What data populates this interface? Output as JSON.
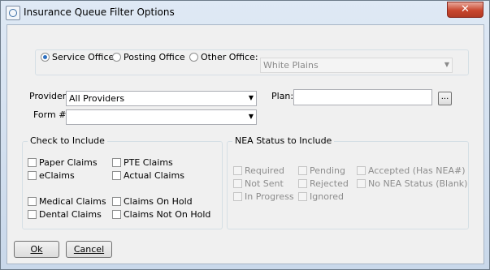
{
  "window": {
    "title": "Insurance Queue Filter Options",
    "close_glyph": "✕"
  },
  "office": {
    "options": [
      {
        "label": "Service Office",
        "selected": true
      },
      {
        "label": "Posting Office",
        "selected": false
      },
      {
        "label": "Other Office:",
        "selected": false
      }
    ],
    "other_office_value": "White Plains"
  },
  "provider": {
    "label": "Provider:",
    "value": "All Providers"
  },
  "form": {
    "label": "Form #:",
    "value": ""
  },
  "plan": {
    "label": "Plan:",
    "value": "",
    "browse_label": "..."
  },
  "check_to_include": {
    "title": "Check to Include",
    "items": [
      "Paper Claims",
      "PTE Claims",
      "eClaims",
      "Actual Claims",
      "Medical Claims",
      "Claims On Hold",
      "Dental Claims",
      "Claims Not On Hold"
    ]
  },
  "nea_status": {
    "title": "NEA Status to Include",
    "items": [
      "Required",
      "Pending",
      "Accepted (Has NEA#)",
      "Not Sent",
      "Rejected",
      "No NEA Status (Blank)",
      "In Progress",
      "Ignored"
    ]
  },
  "buttons": {
    "ok": "Ok",
    "cancel": "Cancel"
  }
}
